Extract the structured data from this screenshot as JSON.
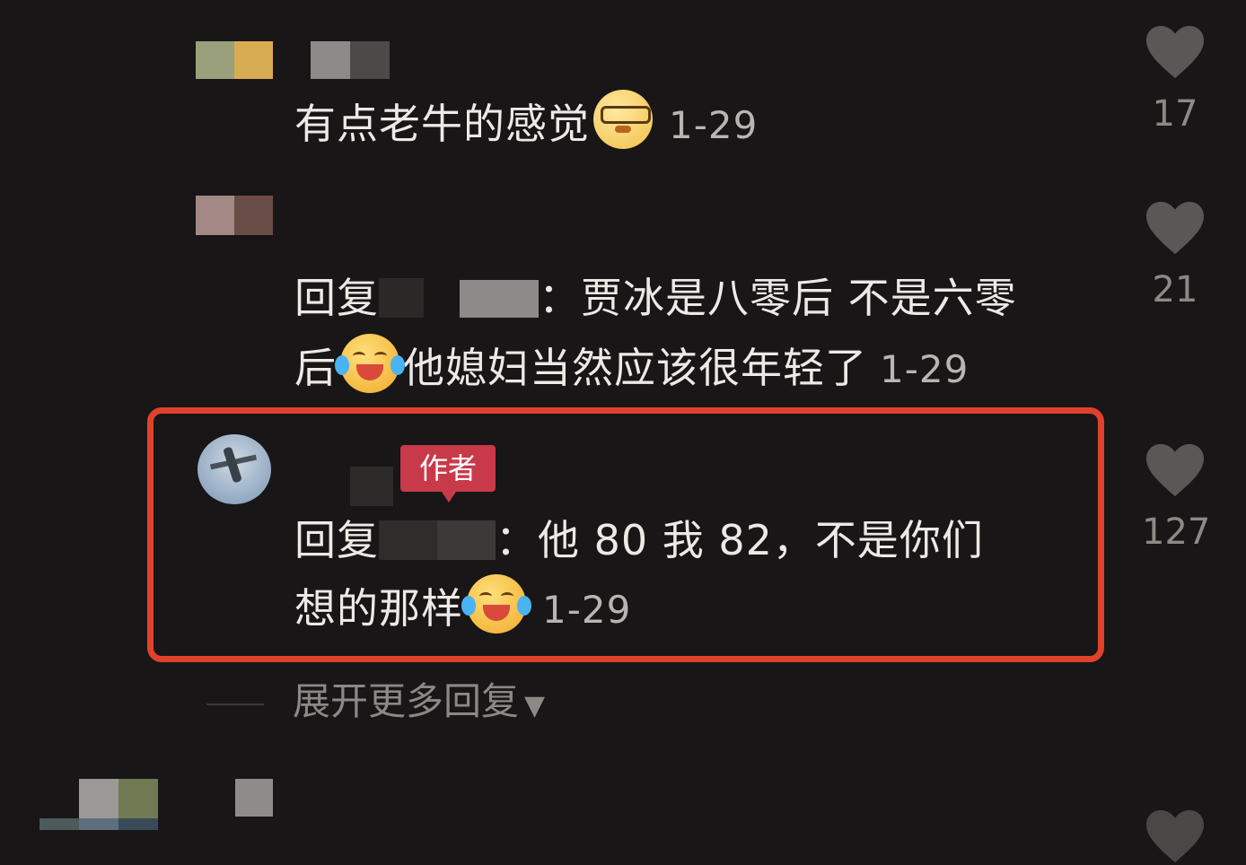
{
  "comments": [
    {
      "id": "c1",
      "text": "有点老牛的感觉",
      "emoji": "sweat-cool-emoji",
      "date": "1-29",
      "likes": "17"
    },
    {
      "id": "c2",
      "reply_prefix": "回复",
      "text_line1": "：贾冰是八零后 不是六零",
      "text_line2_start": "后",
      "emoji": "laugh-cry-emoji",
      "text_line2_end": "他媳妇当然应该很年轻了",
      "date": "1-29",
      "likes": "21"
    },
    {
      "id": "c3",
      "author_badge": "作者",
      "reply_prefix": "回复",
      "text_line1": "：他 80 我 82，不是你们",
      "text_line2": "想的那样",
      "emoji": "laugh-cry-emoji",
      "date": "1-29",
      "likes": "127"
    }
  ],
  "expand_replies": "展开更多回复",
  "colors": {
    "highlight": "#e0412c",
    "author_badge": "#c83a4a",
    "background": "#181616"
  }
}
